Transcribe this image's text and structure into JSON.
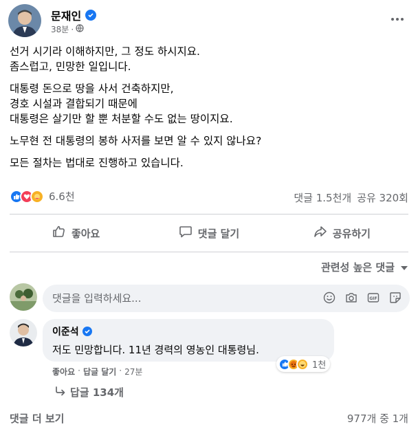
{
  "post": {
    "author": "문재인",
    "time": "38분",
    "separator": "·",
    "paragraphs": [
      [
        "선거 시기라 이해하지만, 그 정도 하시지요.",
        "좀스럽고, 민망한 일입니다."
      ],
      [
        "대통령 돈으로 땅을 사서 건축하지만,",
        "경호 시설과 결합되기 때문에",
        "대통령은 살기만 할 뿐 처분할 수도 없는 땅이지요."
      ],
      [
        "노무현 전 대통령의 봉하 사저를 보면 알 수 있지 않나요?"
      ],
      [
        "모든 절차는 법대로 진행하고 있습니다."
      ]
    ]
  },
  "reactions": {
    "count": "6.6천",
    "comments": "댓글 1.5천개",
    "shares": "공유 320회"
  },
  "actions": {
    "like": "좋아요",
    "comment": "댓글 달기",
    "share": "공유하기"
  },
  "sort_label": "관련성 높은 댓글",
  "comment_input": {
    "placeholder": "댓글을 입력하세요..."
  },
  "comment": {
    "author": "이준석",
    "text": "저도 민망합니다. 11년 경력의 영농인 대통령님.",
    "reaction_count": "1천",
    "like": "좋아요",
    "reply": "답글 달기",
    "time": "27분",
    "dot": "·",
    "replies": "답글 134개"
  },
  "footer": {
    "more": "댓글 더 보기",
    "count": "977개 중 1개"
  },
  "colors": {
    "brand": "#1877f2",
    "love": "#f33e58",
    "care": "#f7b125",
    "secondary": "#65676b",
    "bubble": "#f0f2f5"
  }
}
